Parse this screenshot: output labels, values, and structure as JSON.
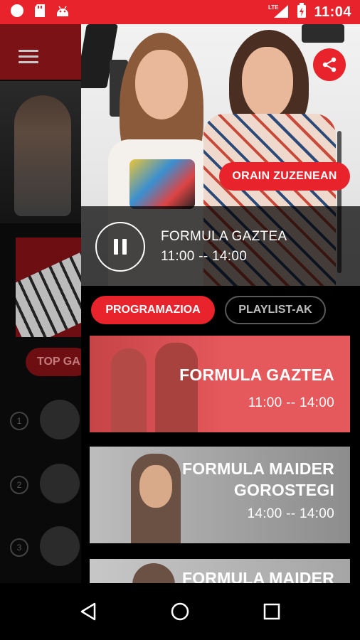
{
  "status_bar": {
    "time": "11:04",
    "network": "LTE",
    "background_color": "#e8232b"
  },
  "background_screen": {
    "pill_label": "TOP GA",
    "rank_numbers": [
      "1",
      "2",
      "3"
    ]
  },
  "now_playing": {
    "live_button_label": "ORAIN ZUZENEAN",
    "show_title": "FORMULA GAZTEA",
    "show_time": "11:00 -- 14:00",
    "state": "playing"
  },
  "tabs": [
    {
      "label": "PROGRAMAZIOA",
      "active": true
    },
    {
      "label": "PLAYLIST-AK",
      "active": false
    }
  ],
  "schedule": [
    {
      "title": "FORMULA GAZTEA",
      "time": "11:00 -- 14:00",
      "highlighted": true
    },
    {
      "title_line1": "FORMULA MAIDER",
      "title_line2": "GOROSTEGI",
      "time": "14:00 -- 14:00",
      "highlighted": false
    },
    {
      "title": "FORMULA MAIDER",
      "highlighted": false
    }
  ],
  "accent_color": "#e8232b",
  "icons": {
    "share": "share-icon",
    "pause": "pause-icon",
    "menu": "hamburger-menu-icon",
    "nav_back": "back-triangle-icon",
    "nav_home": "home-circle-icon",
    "nav_recent": "recent-square-icon"
  }
}
